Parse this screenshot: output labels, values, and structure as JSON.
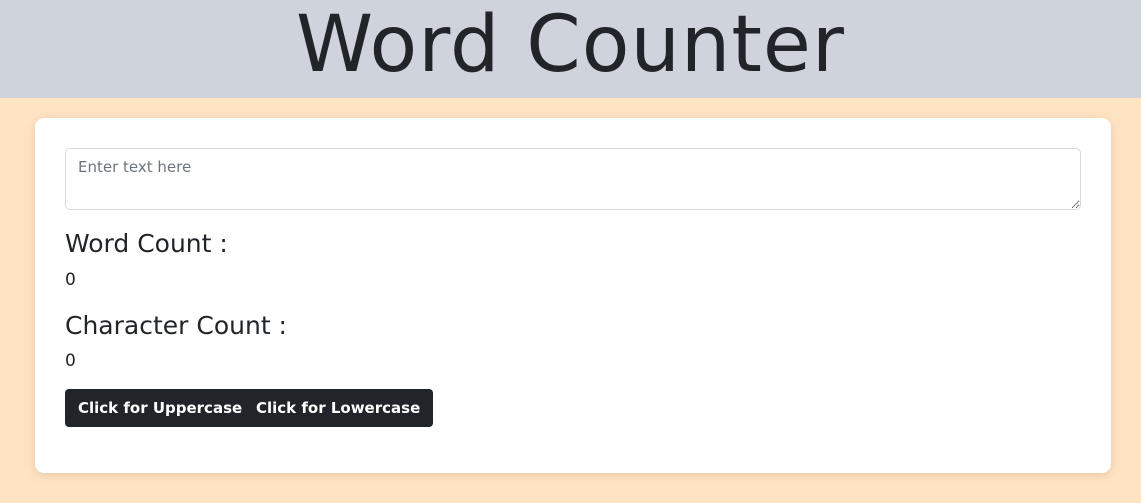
{
  "header": {
    "title": "Word Counter"
  },
  "editor": {
    "value": "",
    "placeholder": "Enter text here"
  },
  "stats": {
    "word_count_label": "Word Count :",
    "word_count_value": "0",
    "character_count_label": "Character Count :",
    "character_count_value": "0"
  },
  "actions": {
    "uppercase_label": "Click for Uppercase",
    "lowercase_label": "Click for Lowercase"
  },
  "colors": {
    "page_background": "#ffe4c4",
    "header_background": "#cfd4dc",
    "button_background": "#212529",
    "button_text": "#ffffff"
  }
}
